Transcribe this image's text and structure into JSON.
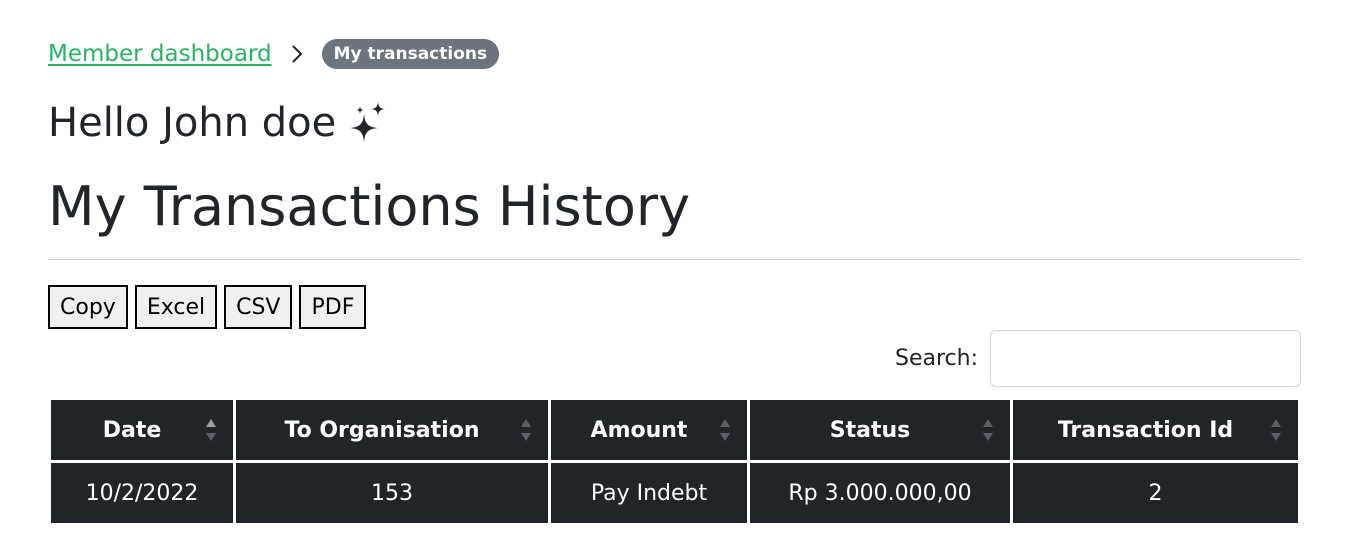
{
  "breadcrumb": {
    "link_label": "Member dashboard",
    "current_label": "My transactions"
  },
  "greeting": "Hello John doe",
  "page_title": "My Transactions History",
  "export_buttons": {
    "copy": "Copy",
    "excel": "Excel",
    "csv": "CSV",
    "pdf": "PDF"
  },
  "search": {
    "label": "Search:",
    "value": "",
    "placeholder": ""
  },
  "table": {
    "columns": [
      "Date",
      "To Organisation",
      "Amount",
      "Status",
      "Transaction Id"
    ],
    "rows": [
      [
        "10/2/2022",
        "153",
        "Pay Indebt",
        "Rp 3.000.000,00",
        "2"
      ]
    ]
  },
  "icons": {
    "breadcrumb_separator": "chevron-right-icon",
    "greeting": "sparkles-icon",
    "sort": "sort-arrows-icon"
  },
  "colors": {
    "link": "#28b463",
    "badge": "#6c757d",
    "table_header_bg": "#212529"
  }
}
